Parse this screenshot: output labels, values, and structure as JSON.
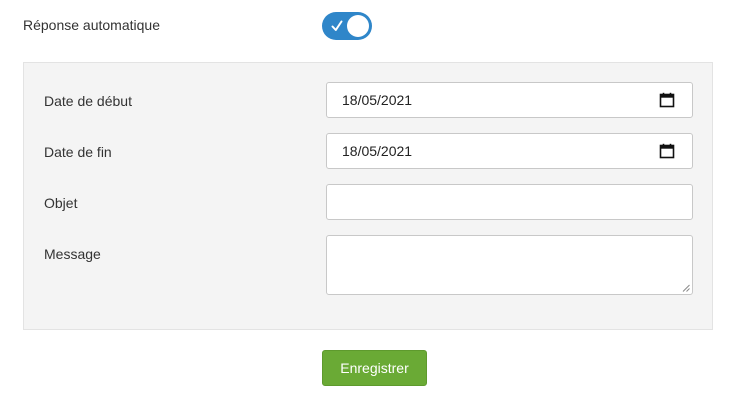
{
  "autoreply": {
    "label": "Réponse automatique",
    "enabled": true,
    "toggle_color": "#2f86c9"
  },
  "form": {
    "start_date": {
      "label": "Date de début",
      "value": "18/05/2021",
      "icon": "calendar-icon"
    },
    "end_date": {
      "label": "Date de fin",
      "value": "18/05/2021",
      "icon": "calendar-icon"
    },
    "subject": {
      "label": "Objet",
      "value": ""
    },
    "message": {
      "label": "Message",
      "value": ""
    }
  },
  "actions": {
    "save_label": "Enregistrer",
    "save_color": "#6aaa35"
  }
}
